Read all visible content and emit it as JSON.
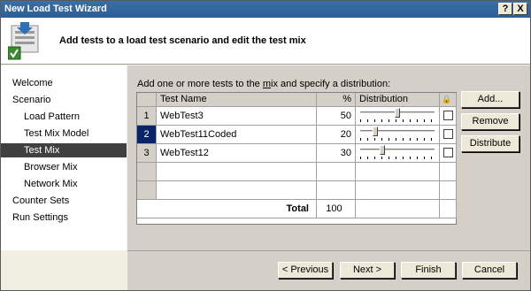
{
  "window": {
    "title": "New Load Test Wizard",
    "help_glyph": "?",
    "close_glyph": "X"
  },
  "header": {
    "text": "Add tests to a load test scenario and edit the test mix"
  },
  "sidebar": {
    "items": [
      {
        "label": "Welcome",
        "indent": false,
        "selected": false
      },
      {
        "label": "Scenario",
        "indent": false,
        "selected": false
      },
      {
        "label": "Load Pattern",
        "indent": true,
        "selected": false
      },
      {
        "label": "Test Mix Model",
        "indent": true,
        "selected": false
      },
      {
        "label": "Test Mix",
        "indent": true,
        "selected": true
      },
      {
        "label": "Browser Mix",
        "indent": true,
        "selected": false
      },
      {
        "label": "Network Mix",
        "indent": true,
        "selected": false
      },
      {
        "label": "Counter Sets",
        "indent": false,
        "selected": false
      },
      {
        "label": "Run Settings",
        "indent": false,
        "selected": false
      }
    ]
  },
  "content": {
    "instruction_pre": "Add one or more tests to the ",
    "instruction_mnemonic": "m",
    "instruction_post": "ix and specify a distribution:",
    "grid": {
      "headers": {
        "name": "Test Name",
        "percent": "%",
        "distribution": "Distribution",
        "lock": "🔒"
      },
      "rows": [
        {
          "index": "1",
          "name": "WebTest3",
          "percent": "50",
          "slider": 0.5,
          "active": false
        },
        {
          "index": "2",
          "name": "WebTest11Coded",
          "percent": "20",
          "slider": 0.2,
          "active": true
        },
        {
          "index": "3",
          "name": "WebTest12",
          "percent": "30",
          "slider": 0.3,
          "active": false
        }
      ],
      "total_label": "Total",
      "total_value": "100"
    },
    "buttons": {
      "add": "Add...",
      "remove": "Remove",
      "distribute": "Distribute"
    }
  },
  "footer": {
    "previous": "< Previous",
    "next": "Next >",
    "finish": "Finish",
    "cancel": "Cancel"
  }
}
